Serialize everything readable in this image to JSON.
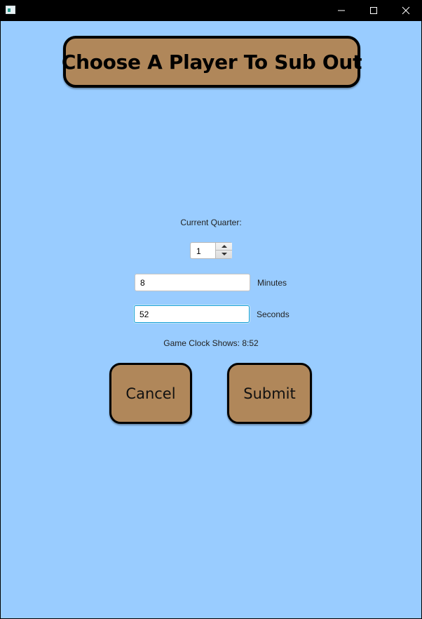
{
  "window": {
    "controls": {
      "minimize": "minimize-icon",
      "maximize": "maximize-icon",
      "close": "close-icon"
    }
  },
  "header": {
    "title": "Choose A Player To Sub Out"
  },
  "form": {
    "quarter_label": "Current Quarter:",
    "quarter_value": "1",
    "minutes_value": "8",
    "minutes_label": "Minutes",
    "seconds_value": "52",
    "seconds_label": "Seconds",
    "clock_text": "Game Clock Shows: 8:52"
  },
  "actions": {
    "cancel_label": "Cancel",
    "submit_label": "Submit"
  },
  "colors": {
    "background": "#99ccff",
    "button": "#b0875a",
    "focus": "#1aa0d8"
  }
}
